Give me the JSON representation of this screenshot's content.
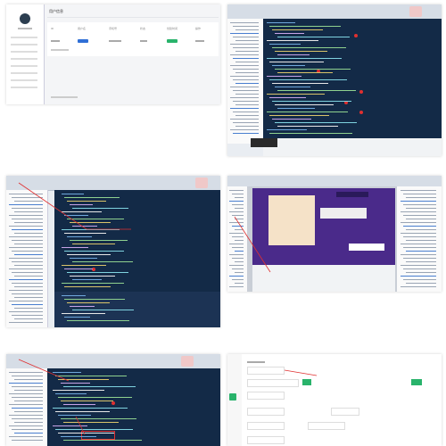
{
  "tile1": {
    "title": "用户信息",
    "table_headers": [
      "ID",
      "用户名",
      "手机号",
      "状态",
      "创建时间",
      "操作"
    ]
  },
  "colors": {
    "editor_bg": "#132a47",
    "annotation": "#e03030",
    "accent": "#2f6fd6",
    "success": "#29b36b"
  }
}
